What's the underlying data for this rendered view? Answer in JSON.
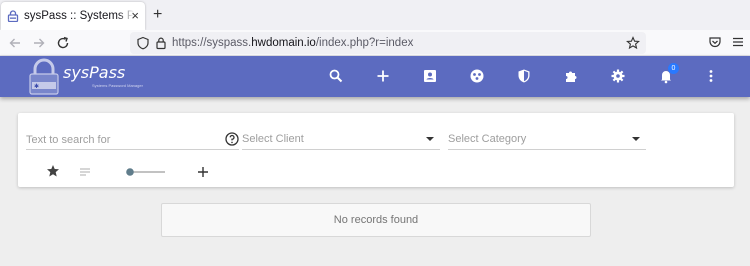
{
  "browser": {
    "tab_title": "sysPass :: Systems Password Manager",
    "tab_close": "×",
    "new_tab": "+",
    "url_prefix": "https://syspass.",
    "url_domain": "hwdomain.io",
    "url_path": "/index.php?r=index"
  },
  "app": {
    "logo_text": "sysPass",
    "logo_subtitle": "Systems Password Manager",
    "notification_count": "0",
    "header_icons": [
      "search-icon",
      "add-icon",
      "account-box-icon",
      "accounts-icon",
      "security-icon",
      "plugin-icon",
      "settings-icon",
      "notifications-icon",
      "more-vert-icon"
    ],
    "accent_color": "#5c6bc0",
    "badge_color": "#2979ff"
  },
  "search": {
    "placeholder": "Text to search for",
    "client_placeholder": "Select Client",
    "category_placeholder": "Select Category"
  },
  "results": {
    "empty_message": "No records found"
  }
}
